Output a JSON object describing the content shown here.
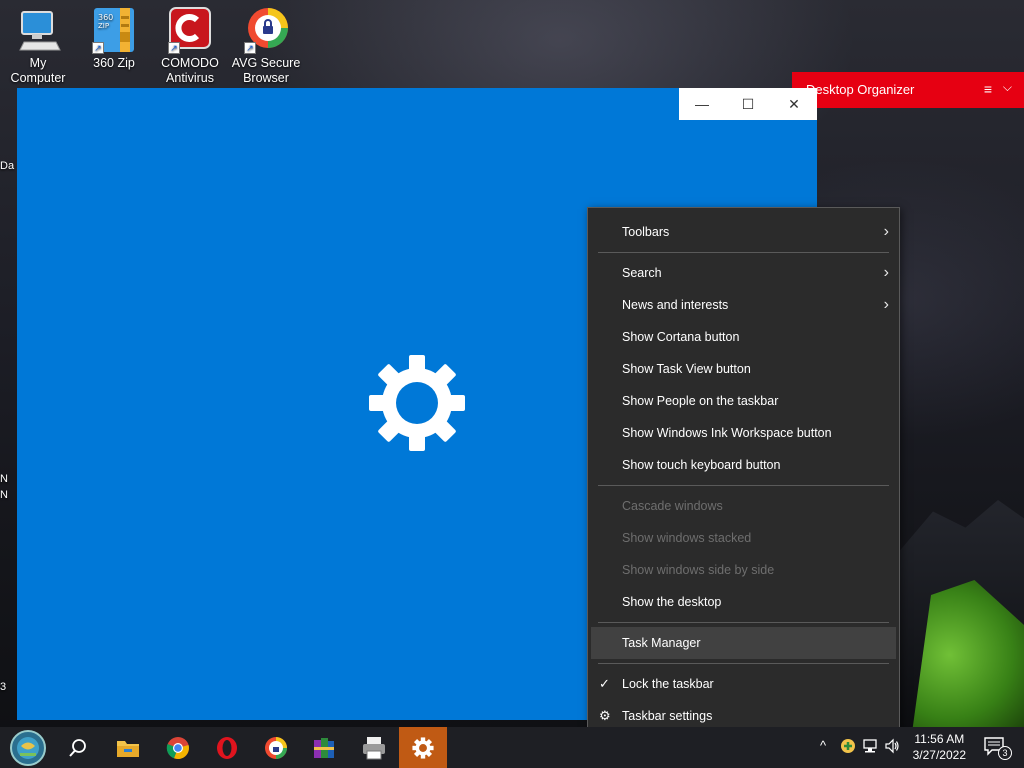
{
  "desktop": {
    "icons": [
      {
        "label": "My\nComputer",
        "icon": "computer-icon"
      },
      {
        "label": "360 Zip",
        "icon": "archive-icon"
      },
      {
        "label": "COMODO\nAntivirus",
        "icon": "comodo-icon"
      },
      {
        "label": "AVG Secure\nBrowser",
        "icon": "avg-browser-icon"
      }
    ],
    "edge_labels": [
      "Da",
      "N",
      "N",
      "3"
    ]
  },
  "organizer": {
    "title": "Desktop Organizer",
    "menu_icon": "≡",
    "chevron": "⌵",
    "color": "#e60012"
  },
  "settings_window": {
    "color": "#0078d7",
    "controls": {
      "minimize": "—",
      "maximize": "☐",
      "close": "✕"
    }
  },
  "context_menu": {
    "toolbars": "Toolbars",
    "search": "Search",
    "news": "News and interests",
    "cortana": "Show Cortana button",
    "task_view": "Show Task View button",
    "people": "Show People on the taskbar",
    "ink": "Show Windows Ink Workspace button",
    "touch_keyboard": "Show touch keyboard button",
    "cascade": "Cascade windows",
    "stacked": "Show windows stacked",
    "side_by_side": "Show windows side by side",
    "show_desktop": "Show the desktop",
    "task_manager": "Task Manager",
    "lock": "Lock the taskbar",
    "settings": "Taskbar settings",
    "submenu_arrow": "›",
    "check": "✓",
    "gear": "⚙"
  },
  "taskbar": {
    "apps": [
      "start-orb-icon",
      "search-icon",
      "file-explorer-icon",
      "chrome-icon",
      "opera-icon",
      "avg-browser-icon",
      "winrar-icon",
      "printer-icon",
      "settings-icon"
    ],
    "active_color": "#c05a14",
    "clock": {
      "time": "11:56 AM",
      "date": "3/27/2022"
    },
    "notification_count": "3"
  }
}
